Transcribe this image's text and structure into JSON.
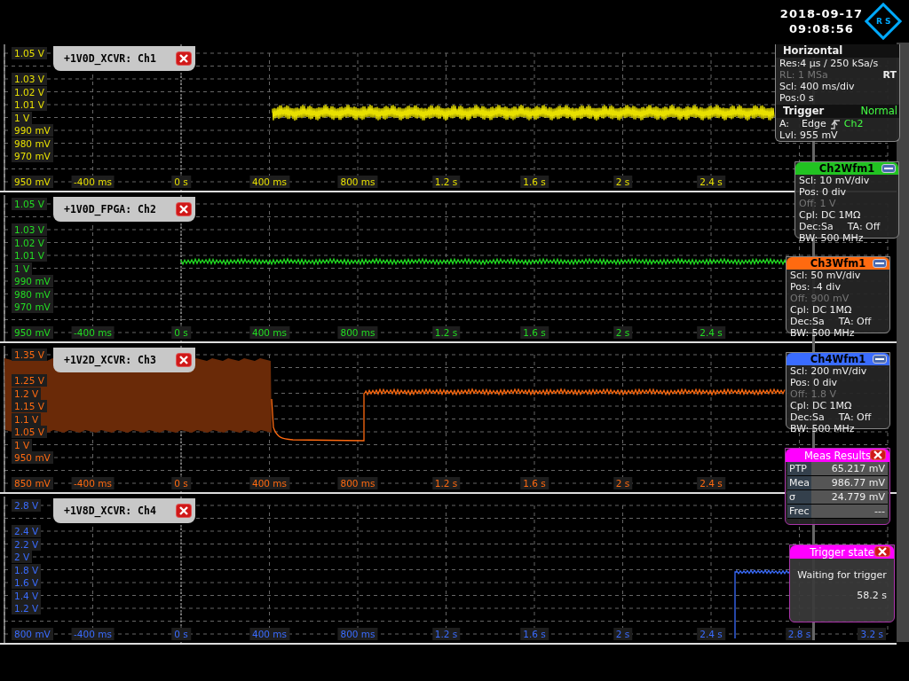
{
  "header": {
    "date": "2018-09-17",
    "time": "09:08:56",
    "logo": "R S"
  },
  "panes": [
    {
      "channel_label": "+1V0D_XCVR: Ch1",
      "color": "#e8e000",
      "y_top": "1.05 V",
      "y_middle": [
        "1.03 V",
        "1.02 V",
        "1.01 V",
        "1 V",
        "990 mV",
        "980 mV",
        "970 mV"
      ],
      "y_bottom": "950 mV",
      "x_labels": [
        "-400 ms",
        "0 s",
        "400 ms",
        "800 ms",
        "1.2 s",
        "1.6 s",
        "2 s",
        "2.4 s"
      ]
    },
    {
      "channel_label": "+1V0D_FPGA: Ch2",
      "color": "#22dd22",
      "y_top": "1.05 V",
      "y_middle": [
        "1.03 V",
        "1.02 V",
        "1.01 V",
        "1 V",
        "990 mV",
        "980 mV",
        "970 mV"
      ],
      "y_bottom": "950 mV",
      "x_labels": [
        "-400 ms",
        "0 s",
        "400 ms",
        "800 ms",
        "1.2 s",
        "1.6 s",
        "2 s",
        "2.4 s"
      ]
    },
    {
      "channel_label": "+1V2D_XCVR: Ch3",
      "color": "#ff6a10",
      "y_top": "1.35 V",
      "y_middle": [
        "1.25 V",
        "1.2 V",
        "1.15 V",
        "1.1 V",
        "1.05 V",
        "1 V",
        "950 mV"
      ],
      "y_bottom": "850 mV",
      "x_labels": [
        "-400 ms",
        "0 s",
        "400 ms",
        "800 ms",
        "1.2 s",
        "1.6 s",
        "2 s",
        "2.4 s"
      ]
    },
    {
      "channel_label": "+1V8D_XCVR: Ch4",
      "color": "#3a6cff",
      "y_top": "2.8 V",
      "y_middle": [
        "2.4 V",
        "2.2 V",
        "2 V",
        "1.8 V",
        "1.6 V",
        "1.4 V",
        "1.2 V"
      ],
      "y_bottom": "800 mV",
      "x_labels": [
        "-400 ms",
        "0 s",
        "400 ms",
        "800 ms",
        "1.2 s",
        "1.6 s",
        "2 s",
        "2.4 s",
        "2.8 s",
        "3.2 s"
      ]
    }
  ],
  "horizontal": {
    "title": "Horizontal",
    "rows": [
      {
        "text": "Res:4 µs / 250 kSa/s",
        "disabled": false
      },
      {
        "text": "RL: 1 MSa",
        "disabled": true
      },
      {
        "text": "Scl: 400 ms/div",
        "disabled": false
      },
      {
        "text": "Pos:0 s",
        "disabled": false
      }
    ],
    "mode": "RT"
  },
  "trigger": {
    "title": "Trigger",
    "mode": "Normal",
    "type_label": "A:",
    "type": "Edge",
    "source": "Ch2",
    "level": "Lvl: 955 mV"
  },
  "channel_panels": [
    {
      "title": "Ch2Wfm1",
      "color": "#22c322",
      "rows": [
        {
          "text": "Scl: 10 mV/div",
          "disabled": false
        },
        {
          "text": "Pos: 0 div",
          "disabled": false
        },
        {
          "text": "Off: 1 V",
          "disabled": true
        },
        {
          "text": "Cpl: DC 1MΩ",
          "disabled": false
        }
      ],
      "dec": "Dec:Sa",
      "ta": "TA: Off",
      "bw": "BW: 500 MHz"
    },
    {
      "title": "Ch3Wfm1",
      "color": "#ff6a10",
      "rows": [
        {
          "text": "Scl: 50 mV/div",
          "disabled": false
        },
        {
          "text": "Pos: -4 div",
          "disabled": false
        },
        {
          "text": "Off: 900 mV",
          "disabled": true
        },
        {
          "text": "Cpl: DC 1MΩ",
          "disabled": false
        }
      ],
      "dec": "Dec:Sa",
      "ta": "TA: Off",
      "bw": "BW: 500 MHz"
    },
    {
      "title": "Ch4Wfm1",
      "color": "#3a6cff",
      "rows": [
        {
          "text": "Scl: 200 mV/div",
          "disabled": false
        },
        {
          "text": "Pos: 0 div",
          "disabled": false
        },
        {
          "text": "Off: 1.8 V",
          "disabled": true
        },
        {
          "text": "Cpl: DC 1MΩ",
          "disabled": false
        }
      ],
      "dec": "Dec:Sa",
      "ta": "TA: Off",
      "bw": "BW: 500 MHz"
    }
  ],
  "meas_results": {
    "title": "Meas Results",
    "rows": [
      {
        "name": "PTP",
        "value": "65.217 mV"
      },
      {
        "name": "Mea",
        "value": "986.77 mV"
      },
      {
        "name": "σ",
        "value": "24.779 mV"
      },
      {
        "name": "Frec",
        "value": "---"
      }
    ]
  },
  "trigger_state": {
    "title": "Trigger state",
    "message": "Waiting for trigger",
    "elapsed": "58.2 s"
  }
}
